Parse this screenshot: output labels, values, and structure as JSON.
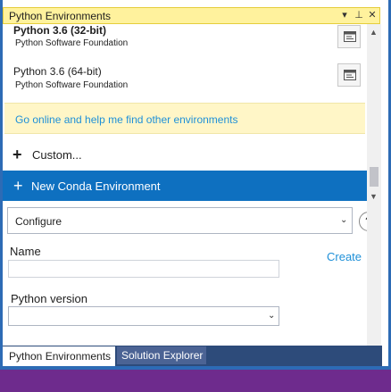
{
  "panel": {
    "title": "Python Environments",
    "title_buttons": [
      "▾",
      "⊥",
      "✕"
    ]
  },
  "environments": [
    {
      "name": "Python 3.6 (32-bit)",
      "org": "Python Software Foundation"
    },
    {
      "name": "Python 3.6 (64-bit)",
      "org": "Python Software Foundation"
    }
  ],
  "online_link": "Go online and help me find other environments",
  "custom": {
    "plus": "+",
    "label": "Custom..."
  },
  "conda": {
    "plus": "+",
    "label": "New Conda Environment"
  },
  "configure": {
    "selected": "Configure",
    "help": "?"
  },
  "form": {
    "name_label": "Name",
    "name_value": "",
    "create_label": "Create",
    "version_label": "Python version",
    "version_value": ""
  },
  "tabs": [
    "Python Environments",
    "Solution Explorer"
  ],
  "colors": {
    "title_bg": "#fff29d",
    "accent_blue": "#0e70c0",
    "link": "#1e90d8",
    "tab_bar": "#2d4b7a",
    "status_purple": "#6e2b8d"
  }
}
